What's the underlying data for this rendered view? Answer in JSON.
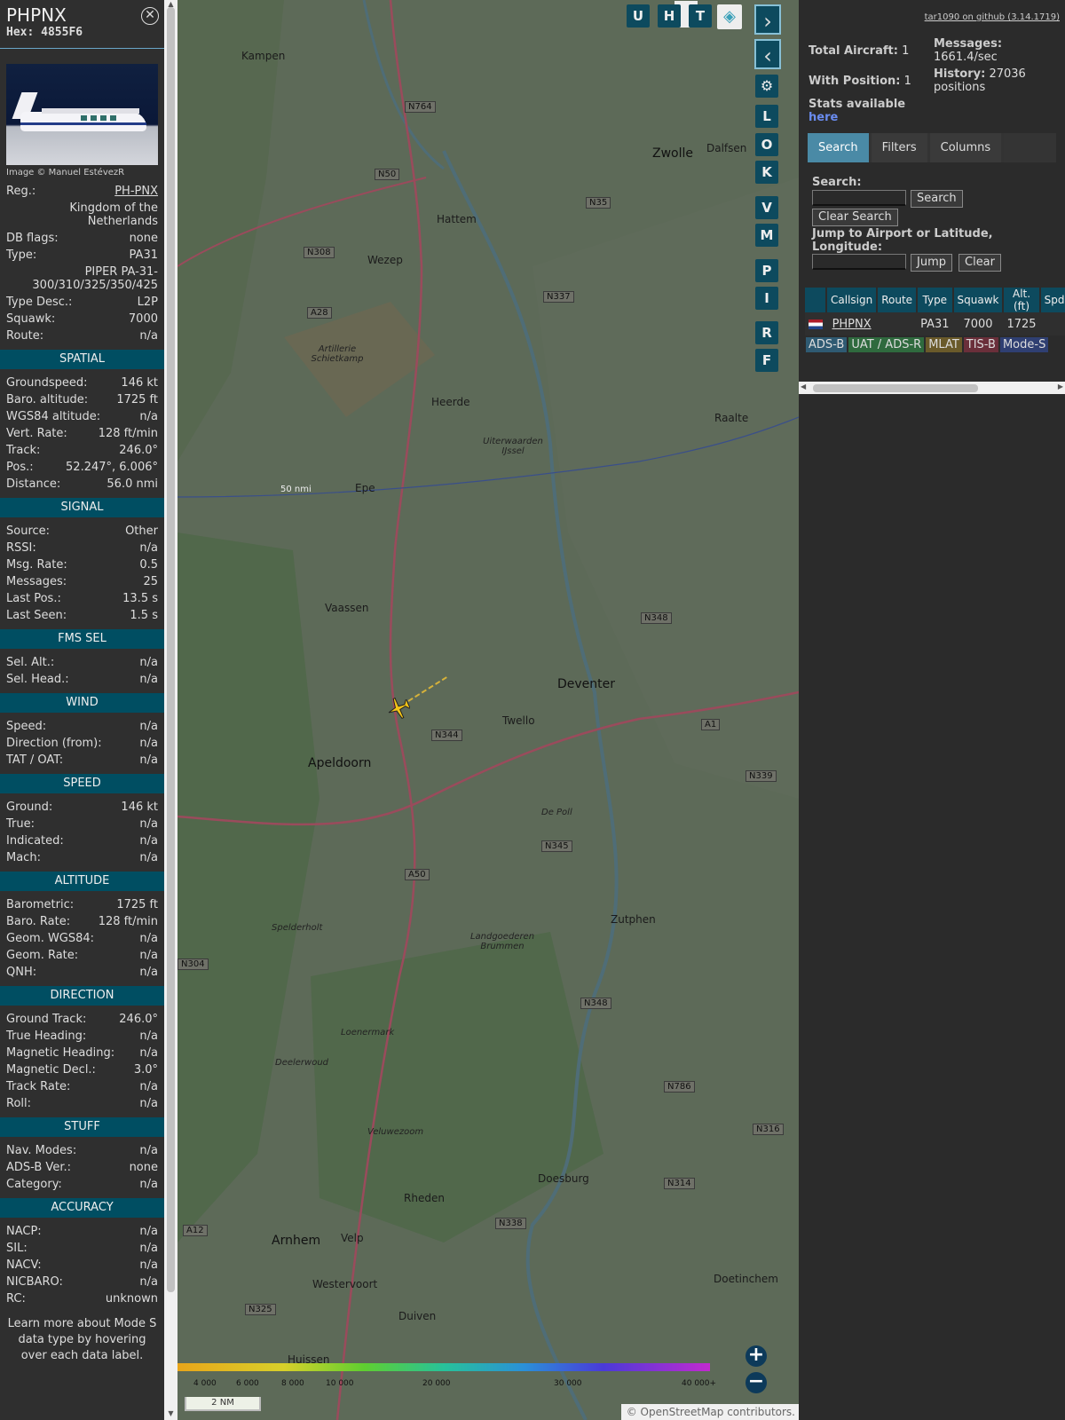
{
  "aircraft": {
    "callsign": "PHPNX",
    "hex_label": "Hex:",
    "hex": "4855F6",
    "photo_credit": "Image © Manuel EstévezR"
  },
  "details": [
    {
      "k": "Reg.:",
      "v": "PH-PNX"
    },
    {
      "k": "",
      "v": "Kingdom of the Netherlands"
    },
    {
      "k": "DB flags:",
      "v": "none"
    },
    {
      "k": "Type:",
      "v": "PA31"
    },
    {
      "k": "",
      "v": "PIPER PA-31-300/310/325/350/425"
    },
    {
      "k": "Type Desc.:",
      "v": "L2P"
    },
    {
      "k": "Squawk:",
      "v": "7000"
    },
    {
      "k": "Route:",
      "v": "n/a"
    }
  ],
  "sections": {
    "spatial": {
      "title": "SPATIAL",
      "rows": [
        {
          "k": "Groundspeed:",
          "v": "146 kt"
        },
        {
          "k": "Baro. altitude:",
          "v": "1725 ft"
        },
        {
          "k": "WGS84 altitude:",
          "v": "n/a"
        },
        {
          "k": "Vert. Rate:",
          "v": "128 ft/min"
        },
        {
          "k": "Track:",
          "v": "246.0°"
        },
        {
          "k": "Pos.:",
          "v": "52.247°, 6.006°"
        },
        {
          "k": "Distance:",
          "v": "56.0 nmi"
        }
      ]
    },
    "signal": {
      "title": "SIGNAL",
      "rows": [
        {
          "k": "Source:",
          "v": "Other"
        },
        {
          "k": "RSSI:",
          "v": "n/a"
        },
        {
          "k": "Msg. Rate:",
          "v": "0.5"
        },
        {
          "k": "Messages:",
          "v": "25"
        },
        {
          "k": "Last Pos.:",
          "v": "13.5 s"
        },
        {
          "k": "Last Seen:",
          "v": "1.5 s"
        }
      ]
    },
    "fms": {
      "title": "FMS SEL",
      "rows": [
        {
          "k": "Sel. Alt.:",
          "v": "n/a"
        },
        {
          "k": "Sel. Head.:",
          "v": "n/a"
        }
      ]
    },
    "wind": {
      "title": "WIND",
      "rows": [
        {
          "k": "Speed:",
          "v": "n/a"
        },
        {
          "k": "Direction (from):",
          "v": "n/a"
        },
        {
          "k": "TAT / OAT:",
          "v": "n/a"
        }
      ]
    },
    "speed": {
      "title": "SPEED",
      "rows": [
        {
          "k": "Ground:",
          "v": "146 kt"
        },
        {
          "k": "True:",
          "v": "n/a"
        },
        {
          "k": "Indicated:",
          "v": "n/a"
        },
        {
          "k": "Mach:",
          "v": "n/a"
        }
      ]
    },
    "altitude": {
      "title": "ALTITUDE",
      "rows": [
        {
          "k": "Barometric:",
          "v": "1725 ft"
        },
        {
          "k": "Baro. Rate:",
          "v": "128 ft/min"
        },
        {
          "k": "Geom. WGS84:",
          "v": "n/a"
        },
        {
          "k": "Geom. Rate:",
          "v": "n/a"
        },
        {
          "k": "QNH:",
          "v": "n/a"
        }
      ]
    },
    "direction": {
      "title": "DIRECTION",
      "rows": [
        {
          "k": "Ground Track:",
          "v": "246.0°"
        },
        {
          "k": "True Heading:",
          "v": "n/a"
        },
        {
          "k": "Magnetic Heading:",
          "v": "n/a"
        },
        {
          "k": "Magnetic Decl.:",
          "v": "3.0°"
        },
        {
          "k": "Track Rate:",
          "v": "n/a"
        },
        {
          "k": "Roll:",
          "v": "n/a"
        }
      ]
    },
    "stuff": {
      "title": "STUFF",
      "rows": [
        {
          "k": "Nav. Modes:",
          "v": "n/a"
        },
        {
          "k": "ADS-B Ver.:",
          "v": "none"
        },
        {
          "k": "Category:",
          "v": "n/a"
        }
      ]
    },
    "accuracy": {
      "title": "ACCURACY",
      "rows": [
        {
          "k": "NACP:",
          "v": "n/a"
        },
        {
          "k": "SIL:",
          "v": "n/a"
        },
        {
          "k": "NACV:",
          "v": "n/a"
        },
        {
          "k": "NICBARO:",
          "v": "n/a"
        },
        {
          "k": "RC:",
          "v": "unknown"
        }
      ]
    }
  },
  "footer_note": "Learn more about Mode S data type by hovering over each data label.",
  "map": {
    "layer_buttons": [
      "U",
      "H",
      "T"
    ],
    "side_buttons": [
      "L",
      "O",
      "K",
      "V",
      "M",
      "P",
      "I",
      "R",
      "F"
    ],
    "range_ring_label": "50 nmi",
    "scale": "2 NM",
    "attribution": "© OpenStreetMap contributors.",
    "legend_ticks": [
      "4 000",
      "6 000",
      "8 000",
      "10 000",
      "20 000",
      "30 000",
      "40 000+"
    ],
    "places": [
      {
        "name": "Zwolle",
        "cls": "city"
      },
      {
        "name": "Kampen",
        "cls": ""
      },
      {
        "name": "Dalfsen",
        "cls": ""
      },
      {
        "name": "Hattem",
        "cls": ""
      },
      {
        "name": "Wezep",
        "cls": ""
      },
      {
        "name": "Heerde",
        "cls": ""
      },
      {
        "name": "Epe",
        "cls": ""
      },
      {
        "name": "Raalte",
        "cls": ""
      },
      {
        "name": "Vaassen",
        "cls": ""
      },
      {
        "name": "Deventer",
        "cls": "city"
      },
      {
        "name": "Twello",
        "cls": ""
      },
      {
        "name": "Apeldoorn",
        "cls": "city"
      },
      {
        "name": "Zutphen",
        "cls": ""
      },
      {
        "name": "Doesburg",
        "cls": ""
      },
      {
        "name": "Rheden",
        "cls": ""
      },
      {
        "name": "Velp",
        "cls": ""
      },
      {
        "name": "Arnhem",
        "cls": "city"
      },
      {
        "name": "Westervoort",
        "cls": ""
      },
      {
        "name": "Duiven",
        "cls": ""
      },
      {
        "name": "Huissen",
        "cls": ""
      },
      {
        "name": "Doetinchem",
        "cls": ""
      }
    ],
    "roads": [
      "N764",
      "N50",
      "N35",
      "N308",
      "N337",
      "A28",
      "N348",
      "N344",
      "A1",
      "N339",
      "N345",
      "A50",
      "N304",
      "N348",
      "N786",
      "N316",
      "N314",
      "N338",
      "N325",
      "A12"
    ],
    "areas": [
      "Artillerie Schietkamp",
      "Uiterwaarden IJssel",
      "Spelderholt",
      "Landgoederen Brummen",
      "Loenermark",
      "Deelerwoud",
      "Veluwezoom",
      "De Poll"
    ]
  },
  "right": {
    "github": "tar1090 on github (3.14.1719)",
    "total_label": "Total Aircraft:",
    "total": "1",
    "pos_label": "With Position:",
    "pos": "1",
    "msg_label": "Messages:",
    "msg": "1661.4/sec",
    "hist_label": "History:",
    "hist": "27036 positions",
    "stats_label": "Stats available",
    "stats_link": "here",
    "tabs": [
      "Search",
      "Filters",
      "Columns"
    ],
    "search_label": "Search:",
    "search_btn": "Search",
    "clear_search_btn": "Clear Search",
    "jump_label": "Jump to Airport or Latitude, Longitude:",
    "jump_btn": "Jump",
    "clear_btn": "Clear",
    "columns": [
      "Callsign",
      "Route",
      "Type",
      "Squawk",
      "Alt. (ft)",
      "Spd."
    ],
    "row": {
      "callsign": "PHPNX",
      "route": "",
      "type": "PA31",
      "squawk": "7000",
      "alt": "1725",
      "spd": ""
    },
    "badges": [
      {
        "label": "ADS-B",
        "color": "#2f5a72"
      },
      {
        "label": "UAT / ADS-R",
        "color": "#2f6a3e"
      },
      {
        "label": "MLAT",
        "color": "#6a5a2a"
      },
      {
        "label": "TIS-B",
        "color": "#6a2f3a"
      },
      {
        "label": "Mode-S",
        "color": "#2f3f72"
      }
    ]
  }
}
